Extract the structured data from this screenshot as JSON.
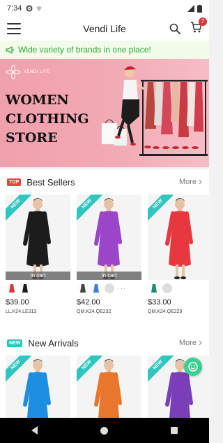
{
  "status": {
    "time": "7:34"
  },
  "appbar": {
    "title": "Vendi Life",
    "cart_count": "7"
  },
  "marquee": {
    "text": "Wide variety of brands in one place!"
  },
  "banner": {
    "logo_text": "VENDI LIFE",
    "headline": [
      "WOMEN",
      "CLOTHING",
      "STORE"
    ]
  },
  "best_sellers": {
    "tag": "TOP",
    "title": "Best Sellers",
    "more": "More",
    "products": [
      {
        "ribbon": "NEW",
        "incart": "In cart",
        "price": "$39.00",
        "sku": "LL.K24.LE313",
        "color": "#1c1c1c",
        "swatches": [
          "#d9363e",
          "#1c1c1c"
        ]
      },
      {
        "ribbon": "NEW",
        "incart": "In cart",
        "price": "$42.00",
        "sku": "QM.K24.QE232",
        "color": "#9b45c9",
        "swatches": [
          "#444444",
          "#3f7dd6",
          "#cccccc"
        ],
        "has_more": true
      },
      {
        "ribbon": "NEW",
        "incart": "",
        "price": "$33.00",
        "sku": "QM.K24.QE229",
        "color": "#e8383f",
        "swatches": [
          "#1f8a70",
          "#cccccc"
        ]
      }
    ]
  },
  "new_arrivals": {
    "tag": "NEW",
    "title": "New Arrivals",
    "more": "More",
    "products": [
      {
        "ribbon": "NEW",
        "color": "#1e8fe0"
      },
      {
        "ribbon": "NEW",
        "color": "#e9762d"
      },
      {
        "ribbon": "NEW",
        "color": "#7a3eb8"
      }
    ]
  },
  "colors": {
    "accent_green": "#2fa83a",
    "badge_red": "#d9363e",
    "ribbon_teal": "#2ec6be",
    "fab_green": "#3ccf93"
  }
}
